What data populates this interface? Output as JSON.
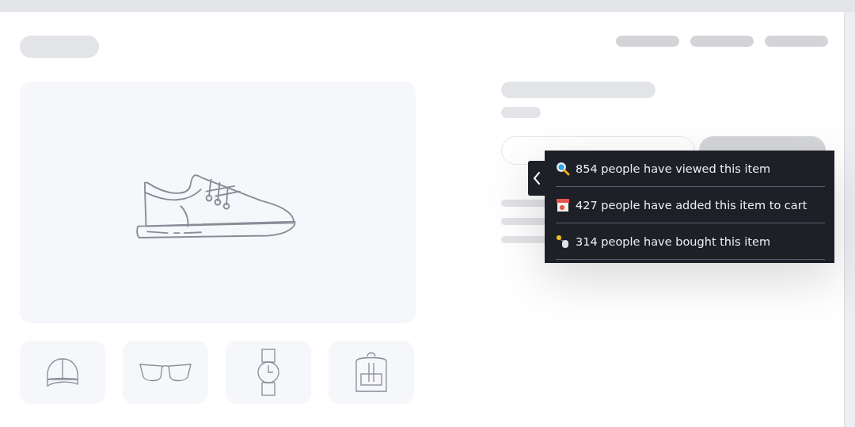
{
  "activity_popup": {
    "items": [
      {
        "text": "854 people have viewed this item"
      },
      {
        "text": "427 people have added this item to cart"
      },
      {
        "text": "314 people have bought this item"
      }
    ]
  }
}
